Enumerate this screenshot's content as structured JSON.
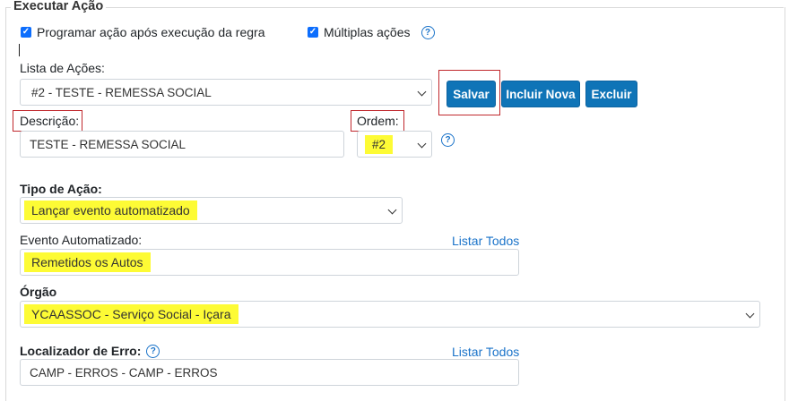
{
  "legend": "Executar Ação",
  "checks": {
    "programar": {
      "label": "Programar ação após execução da regra",
      "checked": true
    },
    "multiplas": {
      "label": "Múltiplas ações",
      "checked": true
    }
  },
  "lista_acoes": {
    "label": "Lista de Ações:",
    "value": "#2 - TESTE - REMESSA SOCIAL"
  },
  "buttons": {
    "salvar": "Salvar",
    "incluir": "Incluir Nova",
    "excluir": "Excluir"
  },
  "descricao": {
    "label": "Descrição:",
    "value": "TESTE - REMESSA SOCIAL"
  },
  "ordem": {
    "label": "Ordem:",
    "value": "#2"
  },
  "tipo_acao": {
    "label": "Tipo de Ação:",
    "value": "Lançar evento automatizado"
  },
  "evento": {
    "label": "Evento Automatizado:",
    "value": "Remetidos os Autos",
    "link": "Listar Todos"
  },
  "orgao": {
    "label": "Órgão",
    "value": "YCAASSOC - Serviço Social - Içara"
  },
  "localizador": {
    "label": "Localizador de Erro:",
    "value": "CAMP - ERROS - CAMP - ERROS",
    "link": "Listar Todos"
  },
  "icons": {
    "help": "?",
    "check": "✓"
  },
  "colors": {
    "primary": "#0f74b7",
    "highlight": "#fdfb35",
    "annotation": "#c0282d",
    "link": "#1a73c9"
  }
}
